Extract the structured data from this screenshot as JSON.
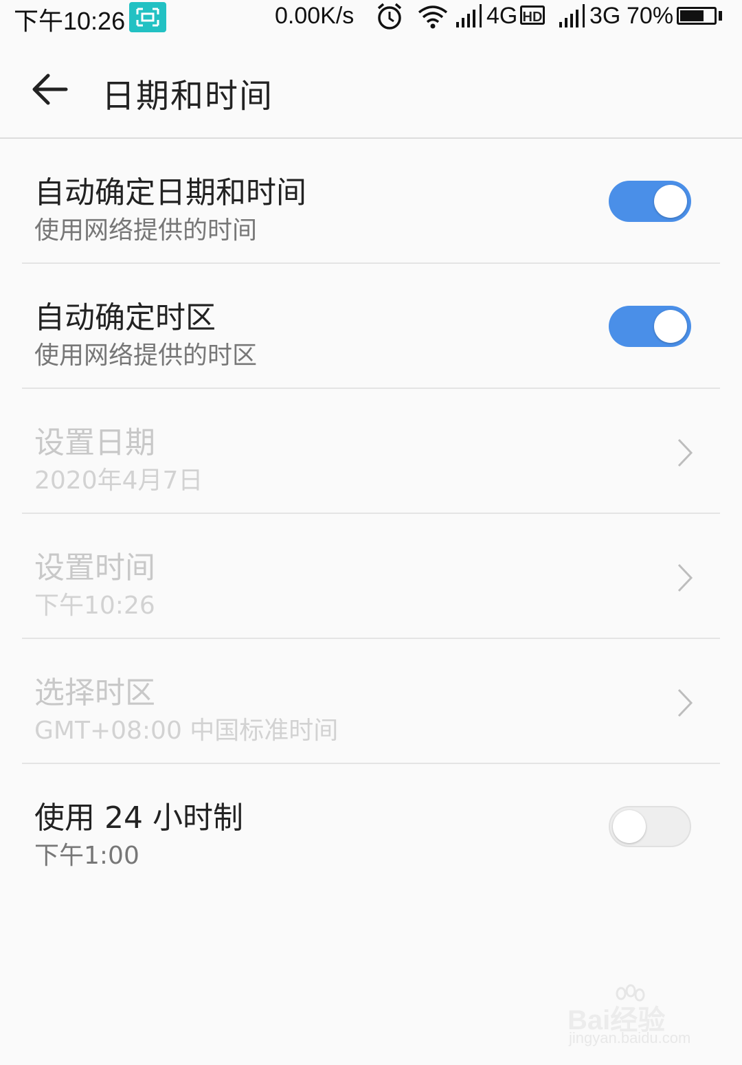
{
  "status_bar": {
    "time": "下午10:26",
    "net_speed": "0.00K/s",
    "network1": "4G",
    "hd_badge": "HD",
    "network2": "3G",
    "battery_percent": "70%",
    "battery_level": 0.7
  },
  "header": {
    "title": "日期和时间"
  },
  "settings": [
    {
      "title": "自动确定日期和时间",
      "subtitle": "使用网络提供的时间",
      "control": "toggle",
      "checked": true,
      "enabled": true
    },
    {
      "title": "自动确定时区",
      "subtitle": "使用网络提供的时区",
      "control": "toggle",
      "checked": true,
      "enabled": true
    },
    {
      "title": "设置日期",
      "subtitle": "2020年4月7日",
      "control": "chevron",
      "enabled": false
    },
    {
      "title": "设置时间",
      "subtitle": "下午10:26",
      "control": "chevron",
      "enabled": false
    },
    {
      "title": "选择时区",
      "subtitle": "GMT+08:00 中国标准时间",
      "control": "chevron",
      "enabled": false
    },
    {
      "title": "使用 24 小时制",
      "subtitle": "下午1:00",
      "control": "toggle",
      "checked": false,
      "enabled": true
    }
  ],
  "colors": {
    "accent": "#4a8fe8",
    "scan_badge": "#22c1c3"
  },
  "watermark": {
    "brand": "Bai经验",
    "url": "jingyan.baidu.com"
  }
}
